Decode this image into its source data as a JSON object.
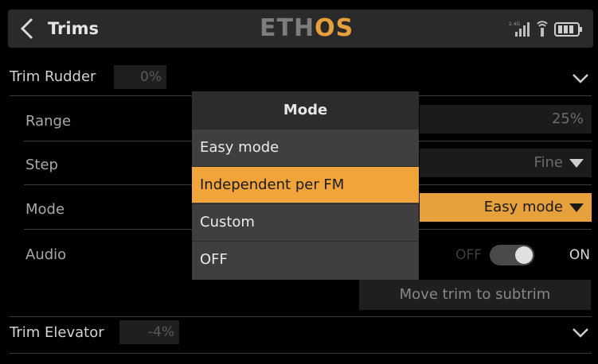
{
  "header": {
    "title": "Trims",
    "logo_main": "ETH",
    "logo_accent": "OS",
    "status_icons": [
      "signal-bars-icon",
      "antenna-icon",
      "battery-icon"
    ],
    "signal_label": "2.4G"
  },
  "groups": [
    {
      "label": "Trim Rudder",
      "value": "0%"
    },
    {
      "label": "Trim Elevator",
      "value": "-4%"
    }
  ],
  "settings": {
    "range_label": "Range",
    "range_value": "25%",
    "step_label": "Step",
    "step_value": "Fine",
    "mode_label": "Mode",
    "mode_value": "Easy mode",
    "audio_label": "Audio",
    "audio_off": "OFF",
    "audio_on": "ON",
    "audio_state": true,
    "move_trim_button": "Move trim to subtrim"
  },
  "dialog": {
    "title": "Mode",
    "options": [
      "Easy mode",
      "Independent per FM",
      "Custom",
      "OFF"
    ],
    "selected_index": 1
  },
  "colors": {
    "accent": "#f0a43a",
    "background": "#000000",
    "panel": "#3f3f3f"
  }
}
